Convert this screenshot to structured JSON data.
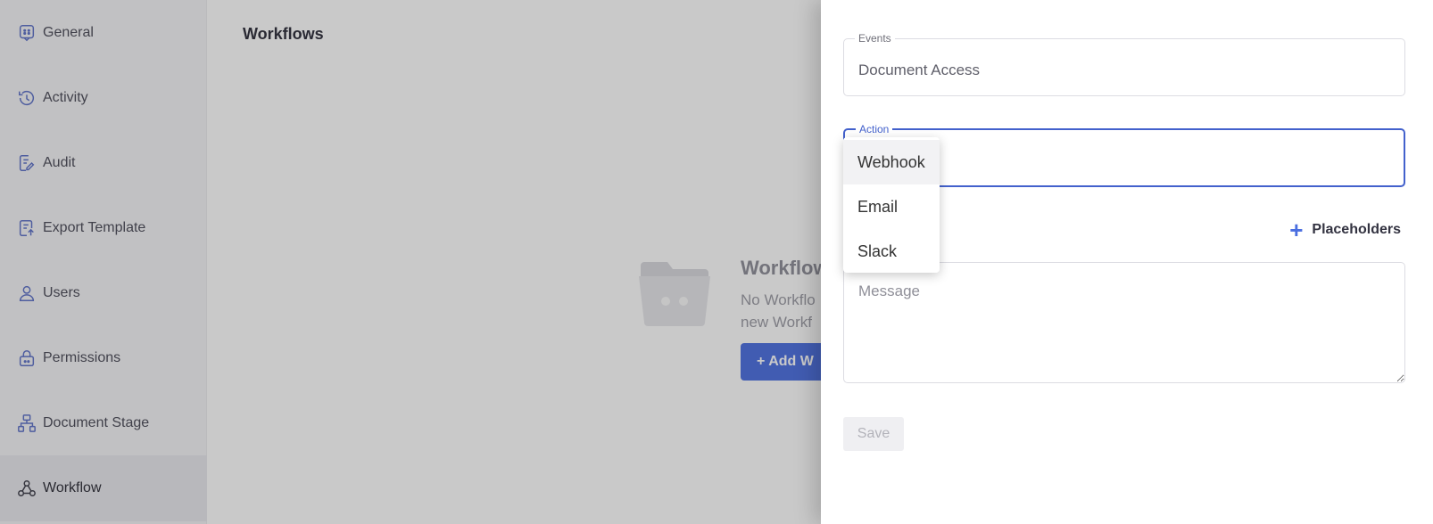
{
  "sidebar": {
    "items": [
      {
        "label": "General",
        "icon": "chat-icon"
      },
      {
        "label": "Activity",
        "icon": "history-icon"
      },
      {
        "label": "Audit",
        "icon": "audit-icon"
      },
      {
        "label": "Export Template",
        "icon": "export-icon"
      },
      {
        "label": "Users",
        "icon": "user-icon"
      },
      {
        "label": "Permissions",
        "icon": "lock-icon"
      },
      {
        "label": "Document Stage",
        "icon": "hierarchy-icon"
      },
      {
        "label": "Workflow",
        "icon": "webhook-icon"
      }
    ],
    "active_index": 7
  },
  "main": {
    "title": "Workflows",
    "empty_state": {
      "title": "Workflow",
      "desc_line1": "No Workflo",
      "desc_line2": "new Workf",
      "button": "+ Add W"
    }
  },
  "drawer": {
    "events": {
      "label": "Events",
      "value": "Document Access"
    },
    "action": {
      "label": "Action",
      "value": ""
    },
    "placeholders_label": "Placeholders",
    "message_placeholder": "Message",
    "save_label": "Save"
  },
  "dropdown": {
    "options": [
      "Webhook",
      "Email",
      "Slack"
    ],
    "selected": "Webhook"
  },
  "colors": {
    "accent": "#4a6ee0",
    "focus": "#4361cc",
    "icon": "#5b6fc7"
  }
}
